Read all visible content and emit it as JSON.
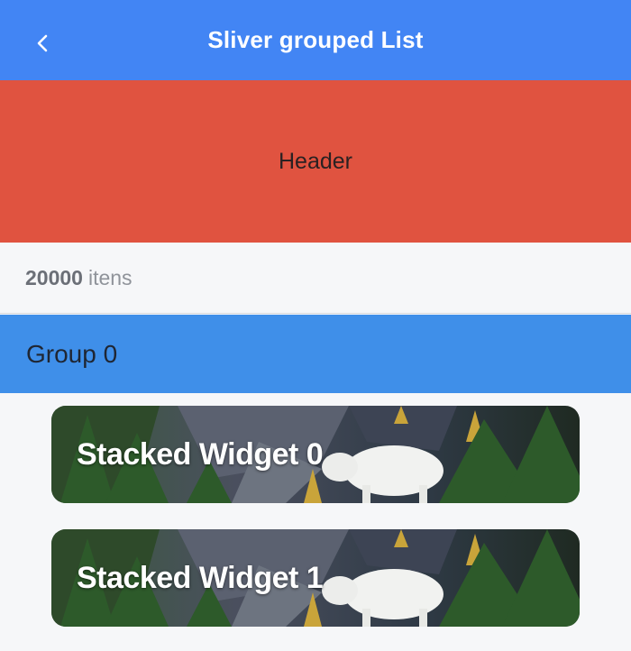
{
  "appbar": {
    "title": "Sliver grouped List",
    "back_icon": "chevron-left-icon"
  },
  "header": {
    "label": "Header"
  },
  "count": {
    "number": "20000",
    "unit": "itens"
  },
  "group": {
    "title": "Group 0"
  },
  "cards": [
    {
      "title": "Stacked Widget 0"
    },
    {
      "title": "Stacked Widget 1"
    }
  ],
  "colors": {
    "appbar": "#4285f4",
    "header": "#e05340",
    "group": "#3f8fe9",
    "background": "#f6f7f9"
  }
}
